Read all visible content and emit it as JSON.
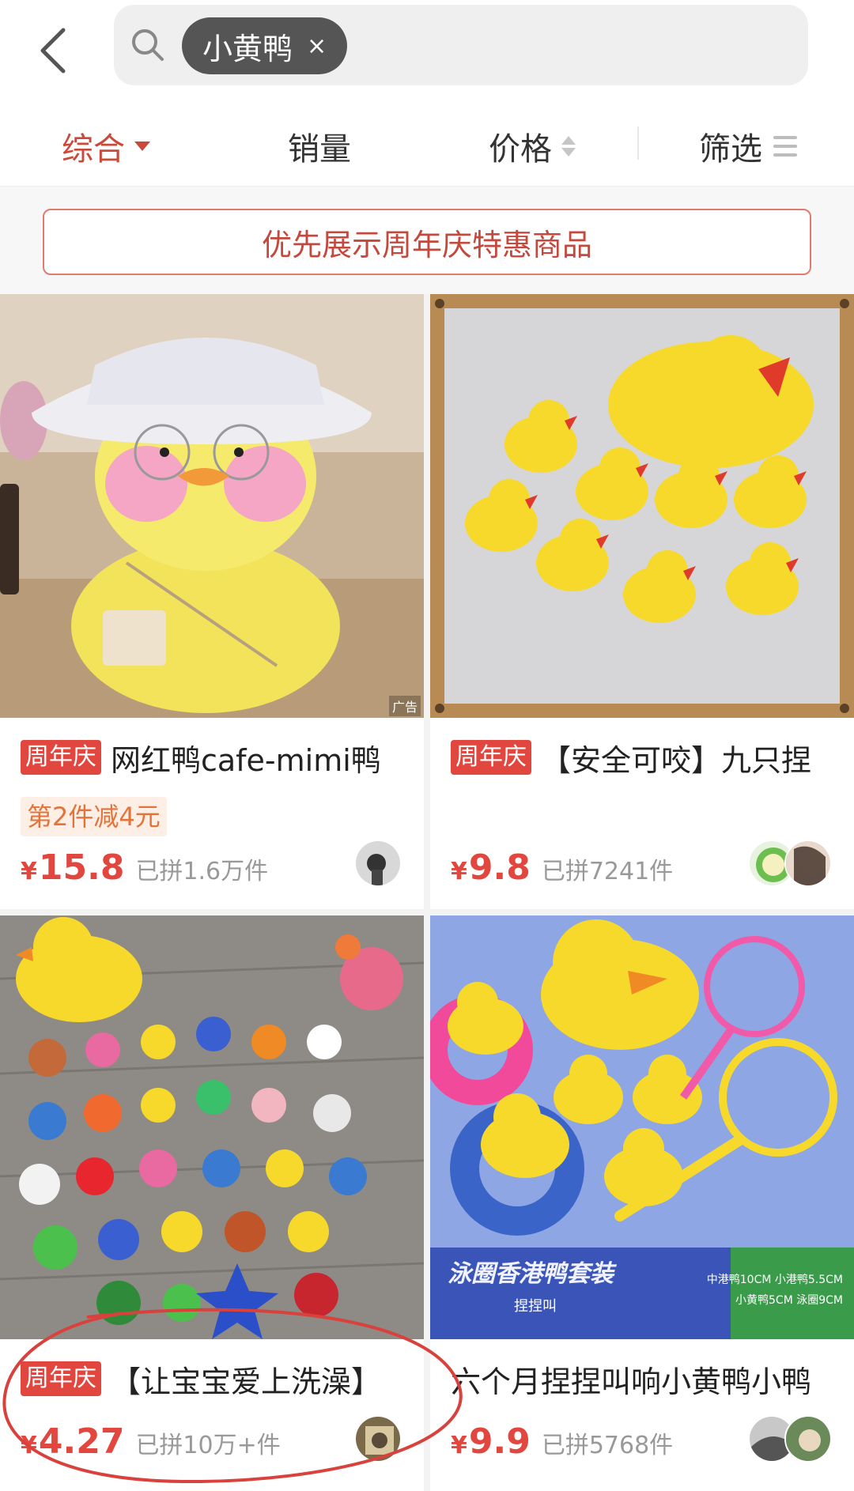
{
  "search": {
    "keyword": "小黄鸭",
    "chip_close": "×"
  },
  "sort_bar": {
    "comprehensive": "综合",
    "sales": "销量",
    "price": "价格",
    "filter": "筛选"
  },
  "promo": {
    "text": "优先展示周年庆特惠商品"
  },
  "products": [
    {
      "tag": "周年庆",
      "title": "网红鸭cafe-mimi鸭",
      "discount": "第2件减4元",
      "price_symbol": "¥",
      "price": "15.8",
      "sold": "已拼1.6万件",
      "ad_mark": "广告"
    },
    {
      "tag": "周年庆",
      "title": "【安全可咬】九只捏",
      "price_symbol": "¥",
      "price": "9.8",
      "sold": "已拼7241件"
    },
    {
      "tag": "周年庆",
      "title": "【让宝宝爱上洗澡】",
      "price_symbol": "¥",
      "price": "4.27",
      "sold": "已拼10万+件"
    },
    {
      "tag": "",
      "title": "六个月捏捏叫响小黄鸭小鸭",
      "price_symbol": "¥",
      "price": "9.9",
      "sold": "已拼5768件",
      "image_caption": "泳圈香港鸭套装",
      "image_caption_sub": "捏捏叫",
      "image_specs": [
        "中港鸭10CM 小港鸭5.5CM",
        "小黄鸭5CM 泳圈9CM"
      ]
    }
  ],
  "colors": {
    "accent": "#e2473f",
    "active_sort": "#c94a3a",
    "annotation_circle": "#d9413c"
  }
}
